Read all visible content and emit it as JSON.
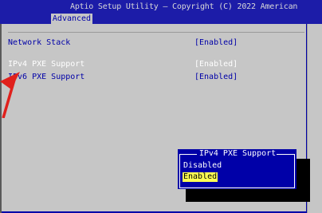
{
  "header": {
    "title": "Aptio Setup Utility – Copyright (C) 2022 American",
    "tab": "Advanced"
  },
  "settings": [
    {
      "label": "Network Stack",
      "value": "[Enabled]"
    },
    {
      "label": "IPv4 PXE Support",
      "value": "[Enabled]"
    },
    {
      "label": "IPv6 PXE Support",
      "value": "[Enabled]"
    }
  ],
  "popup": {
    "title": "IPv4 PXE Support",
    "options": [
      "Disabled",
      "Enabled"
    ],
    "selected": "Enabled"
  },
  "colors": {
    "background": "#0000a8",
    "panel": "#c6c6c6",
    "highlight": "#ffff54",
    "annotation": "#e0201c"
  }
}
